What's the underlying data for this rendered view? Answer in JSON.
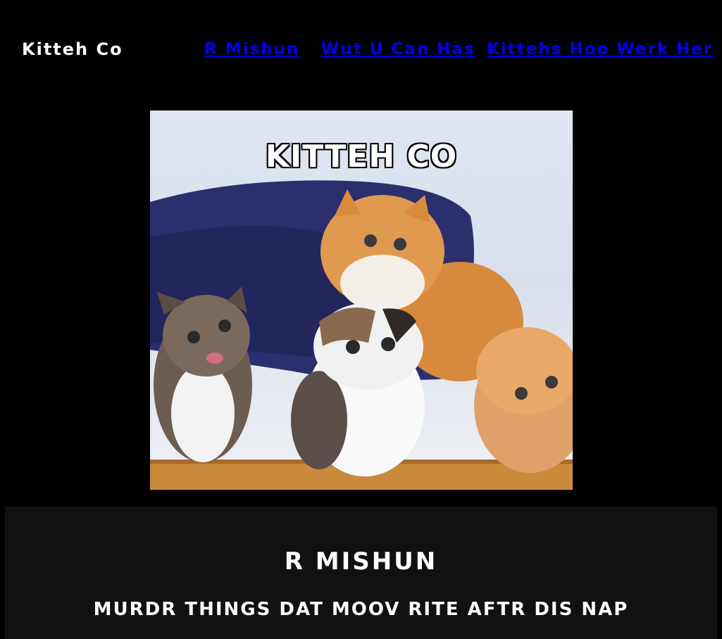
{
  "header": {
    "brand": "Kitteh Co",
    "nav": [
      {
        "label": "R Mishun"
      },
      {
        "label": "Wut U Can Has"
      },
      {
        "label": "Kittehs Hoo Werk Her"
      }
    ],
    "link_color": "#0000ee"
  },
  "hero": {
    "caption": "KITTEH CO",
    "image_subject": "five kittens on a blue cat bed"
  },
  "mission": {
    "title": "R MISHUN",
    "text": "MURDR THINGS DAT MOOV RITE AFTR DIS NAP"
  },
  "colors": {
    "background": "#000000",
    "section_background": "#111111",
    "text": "#ffffff"
  }
}
